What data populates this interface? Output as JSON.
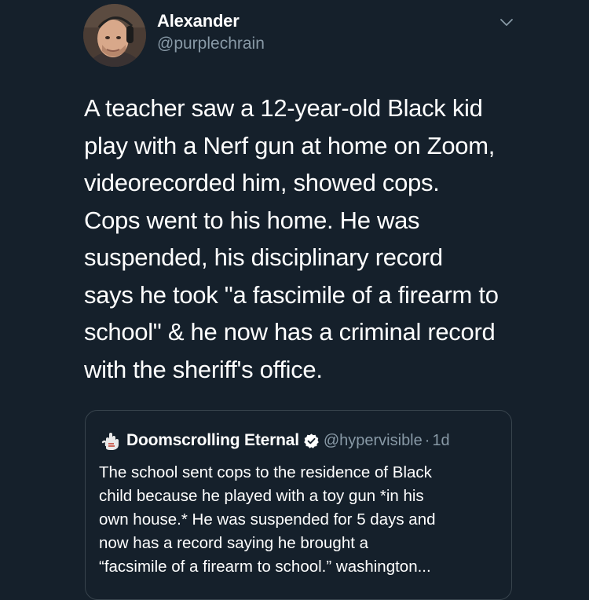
{
  "author": {
    "name": "Alexander",
    "handle": "@purplechrain"
  },
  "tweet": {
    "lines": [
      "A teacher saw a 12-year-old Black kid",
      "play with a Nerf gun at home on Zoom,",
      "videorecorded him, showed cops.",
      "Cops went to his home. He was",
      "suspended, his disciplinary record",
      "says he took \"a fascimile of a firearm to",
      "school\" & he now has a criminal record",
      "with the sheriff's office."
    ]
  },
  "quoted": {
    "name": "Doomscrolling Eternal",
    "handle": "@hypervisible",
    "separator": "·",
    "time": "1d",
    "lines": [
      "The school sent cops to the residence of Black",
      "child because he played with a toy gun *in his",
      "own house.* He was suspended for 5 days and",
      "now has a record saying he brought a",
      "“facsimile of a firearm to school.” washington..."
    ]
  },
  "icons": {
    "menu": "chevron-down-icon",
    "verified": "verified-badge-icon",
    "quoted_avatar": "raised-hand-avatar"
  },
  "colors": {
    "background": "#15202b",
    "text": "#ffffff",
    "secondary": "#8899a6",
    "border": "#38444d",
    "verified": "#ffffff"
  }
}
